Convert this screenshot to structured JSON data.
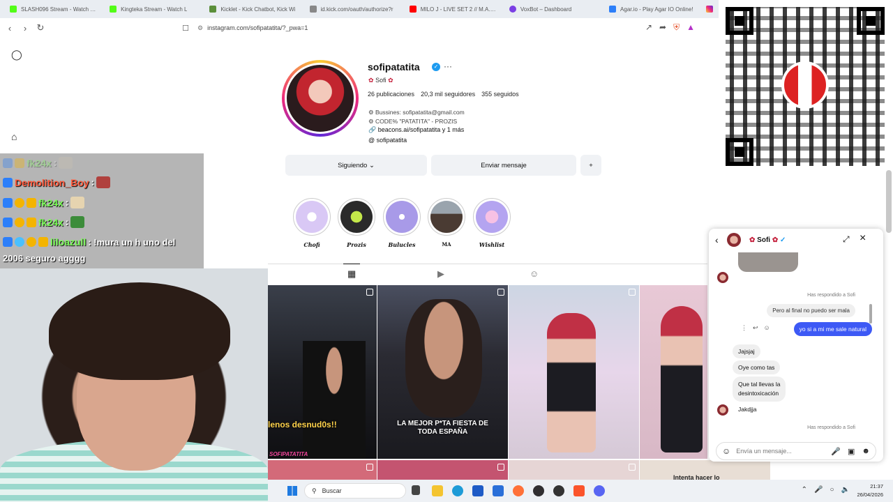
{
  "browser": {
    "tabs": [
      {
        "title": "SLASH096 Stream - Watch Liv",
        "color": "#53fc18"
      },
      {
        "title": "Kingteka Stream - Watch L",
        "color": "#53fc18"
      },
      {
        "title": "Kicklet - Kick Chatbot, Kick Wi",
        "color": "#5b8f3a"
      },
      {
        "title": "id.kick.com/oauth/authorize?r",
        "color": "#888888"
      },
      {
        "title": "MILO J - LIVE SET 2 // M.A.I. DI",
        "color": "#ff0000"
      },
      {
        "title": "VoxBot – Dashboard",
        "color": "#7b3fe4"
      },
      {
        "title": "Agar.io - Play Agar IO Online!",
        "color": "#2d7ff9"
      }
    ],
    "url": "instagram.com/sofipatatita/?_pwa=1"
  },
  "profile": {
    "username": "sofipatatita",
    "display_name": "Sofi",
    "posts": "26 publicaciones",
    "followers": "20,3 mil seguidores",
    "following": "355 seguidos",
    "bio_line1": "Bussines: sofipatatita@gmail.com",
    "bio_line2": "CODE% \"PATATITA\" - PROZIS",
    "link": "beacons.ai/sofipatatita y 1 más",
    "threads": "sofipatatita",
    "btn_following": "Siguiendo",
    "btn_message": "Enviar mensaje"
  },
  "highlights": [
    {
      "label": "Chofi",
      "color": "#d9c8f5"
    },
    {
      "label": "Prozis",
      "color": "#2a2a2a"
    },
    {
      "label": "Bulucles",
      "color": "#a89ae8"
    },
    {
      "label": "MA",
      "color": "#4a3b33"
    },
    {
      "label": "Wishlist",
      "color": "#b4a4f0"
    }
  ],
  "posts": [
    {
      "caption": "lenos desnud0s!!"
    },
    {
      "caption": "LA MEJOR P*TA FIESTA DE TODA ESPAÑA"
    },
    {
      "caption": ""
    },
    {
      "caption": ""
    }
  ],
  "post_footer_tag": "SOFIPATATITA",
  "post_bottom_text": "Intenta hacer lo",
  "chat": [
    {
      "nick": "fk24x",
      "text": ":",
      "faded": true,
      "red": false
    },
    {
      "nick": "Demolition_Boy",
      "text": ":",
      "faded": false,
      "red": true
    },
    {
      "nick": "fk24x",
      "text": ":",
      "faded": false,
      "red": false
    },
    {
      "nick": "fk24x",
      "text": ":",
      "faded": false,
      "red": false
    },
    {
      "nick": "liloazull",
      "text": ": !mura un h uno del",
      "faded": false,
      "red": false
    },
    {
      "nick": "",
      "text": "2006 seguro agggg",
      "faded": false,
      "red": false
    }
  ],
  "dm": {
    "name": "Sofi",
    "replied_1": "Has respondido a Sofi",
    "quote": "Pero al final no puedo ser mala",
    "out_msg": "yo si a mi me sale natural",
    "in_1": "Jajsjaj",
    "in_2": "Oye como tas",
    "in_3_line1": "Que tal llevas la",
    "in_3_line2": "desintoxicación",
    "in_4": "Jakdjja",
    "replied_2": "Has respondido a Sofi",
    "input_placeholder": "Envía un mensaje..."
  },
  "taskbar": {
    "search": "Buscar",
    "time": "21:37",
    "date": "26/04/2026"
  }
}
